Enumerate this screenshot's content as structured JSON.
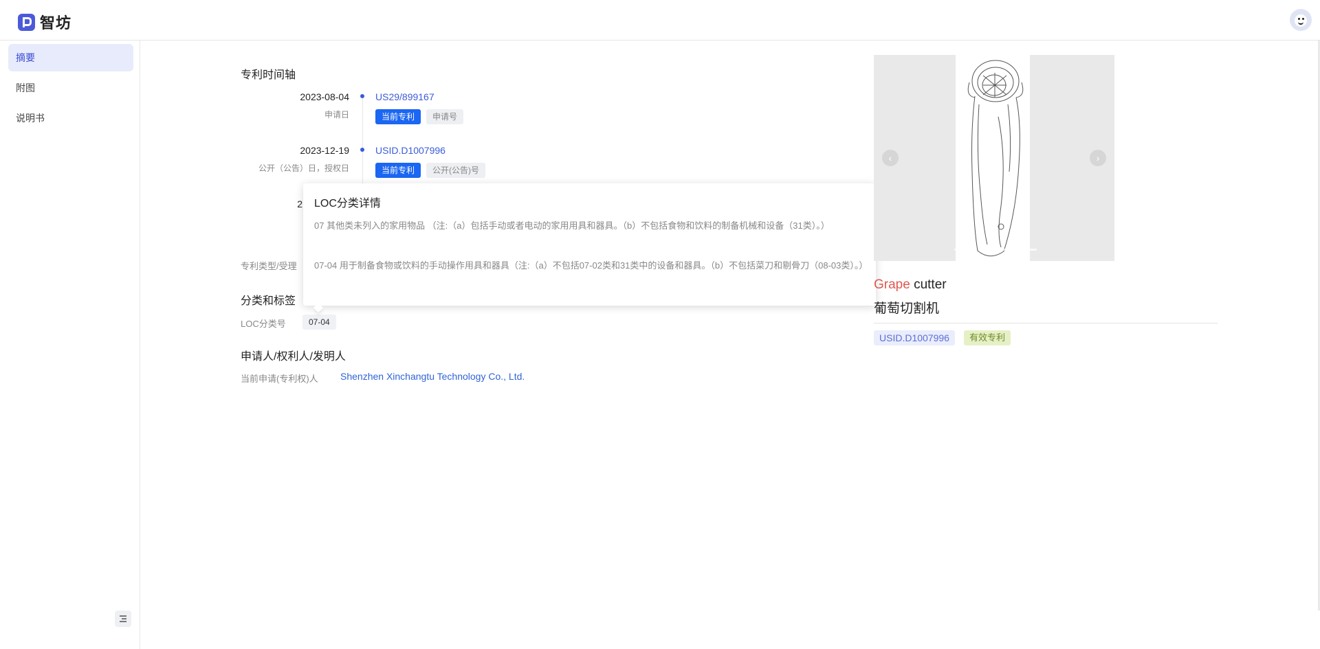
{
  "app": {
    "name": "智坊"
  },
  "sidebar": {
    "items": [
      {
        "label": "摘要",
        "active": true
      },
      {
        "label": "附图",
        "active": false
      },
      {
        "label": "说明书",
        "active": false
      }
    ]
  },
  "timeline": {
    "title": "专利时间轴",
    "entries": [
      {
        "date": "2023-08-04",
        "label": "申请日",
        "number": "US29/899167",
        "tags": [
          "当前专利",
          "申请号"
        ]
      },
      {
        "date": "2023-12-19",
        "label": "公开（公告）日，授权日",
        "number": "USID.D1007996",
        "tags": [
          "当前专利",
          "公开(公告)号"
        ]
      },
      {
        "date": "2"
      }
    ]
  },
  "patent_type_label": "专利类型/受理",
  "classification": {
    "title": "分类和标签",
    "loc_label": "LOC分类号",
    "loc_value": "07-04"
  },
  "applicants": {
    "title": "申请人/权利人/发明人",
    "current_label": "当前申请(专利权)人",
    "current_value": "Shenzhen Xinchangtu Technology Co., Ltd."
  },
  "popover": {
    "title": "LOC分类详情",
    "lines": [
      "07 其他类未列入的家用物品 （注:（a）包括手动或者电动的家用用具和器具。（b）不包括食物和饮料的制备机械和设备（31类）。）",
      "07-04 用于制备食物或饮料的手动操作用具和器具（注:（a）不包括07-02类和31类中的设备和器具。（b）不包括菜刀和剔骨刀（08-03类）。）"
    ]
  },
  "product": {
    "title_en_highlight": "Grape",
    "title_en_rest": " cutter",
    "title_zh": "葡萄切割机",
    "number": "USID.D1007996",
    "status": "有效专利"
  }
}
